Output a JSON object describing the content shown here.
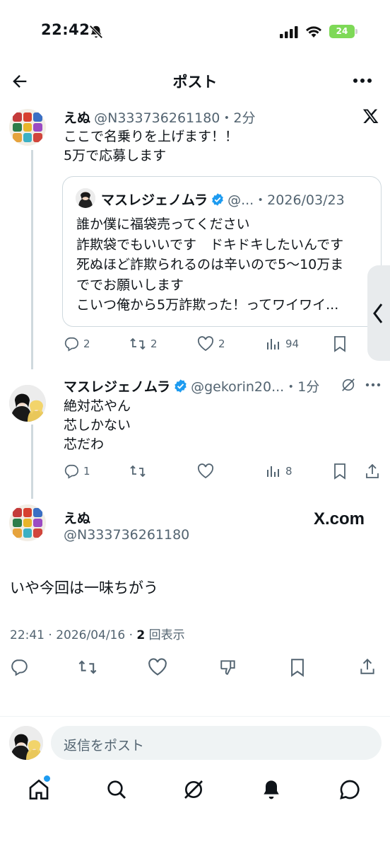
{
  "status_bar": {
    "time": "22:42",
    "battery": "24"
  },
  "header": {
    "title": "ポスト"
  },
  "post1": {
    "name": "えぬ",
    "meta": "@N333736261180・2分",
    "lines": [
      "ここで名乗りを上げます！！",
      "5万で応募します"
    ],
    "quote": {
      "name": "マスレジェノムラ",
      "meta": "@...・2026/03/23",
      "lines": [
        "誰か僕に福袋売ってください",
        "詐欺袋でもいいです　ドキドキしたいんです",
        "死ぬほど詐欺られるのは辛いので5〜10万ま",
        "ででお願いします",
        "こいつ俺から5万詐欺った！ってワイワイ..."
      ]
    },
    "actions": {
      "replies": "2",
      "reposts": "2",
      "likes": "2",
      "views": "94"
    }
  },
  "post2": {
    "name": "マスレジェノムラ",
    "meta": "@gekorin20...・1分",
    "lines": [
      "絶対芯やん",
      "芯しかない",
      "芯だわ"
    ],
    "actions": {
      "replies": "1",
      "reposts": "",
      "likes": "",
      "views": "8"
    }
  },
  "main_post": {
    "name": "えぬ",
    "handle": "@N333736261180",
    "brand": "X.com",
    "text": "いや今回は一味ちがう",
    "time": "22:41 · 2026/04/16 · ",
    "view_count": "2",
    "view_label": " 回表示"
  },
  "reply_bar": {
    "placeholder": "返信をポスト"
  },
  "colors": {
    "accent": "#1d9bf0",
    "verified": "#1d9bf0",
    "text": "#0f1419",
    "muted": "#536471"
  },
  "icons": [
    "bell-slash-icon",
    "signal-icon",
    "wifi-icon",
    "back-arrow-icon",
    "more-icon",
    "x-logo-icon",
    "reply-icon",
    "repost-icon",
    "like-icon",
    "views-icon",
    "bookmark-icon",
    "share-icon",
    "grok-icon",
    "dislike-icon",
    "home-icon",
    "search-icon",
    "notifications-icon",
    "messages-icon"
  ]
}
